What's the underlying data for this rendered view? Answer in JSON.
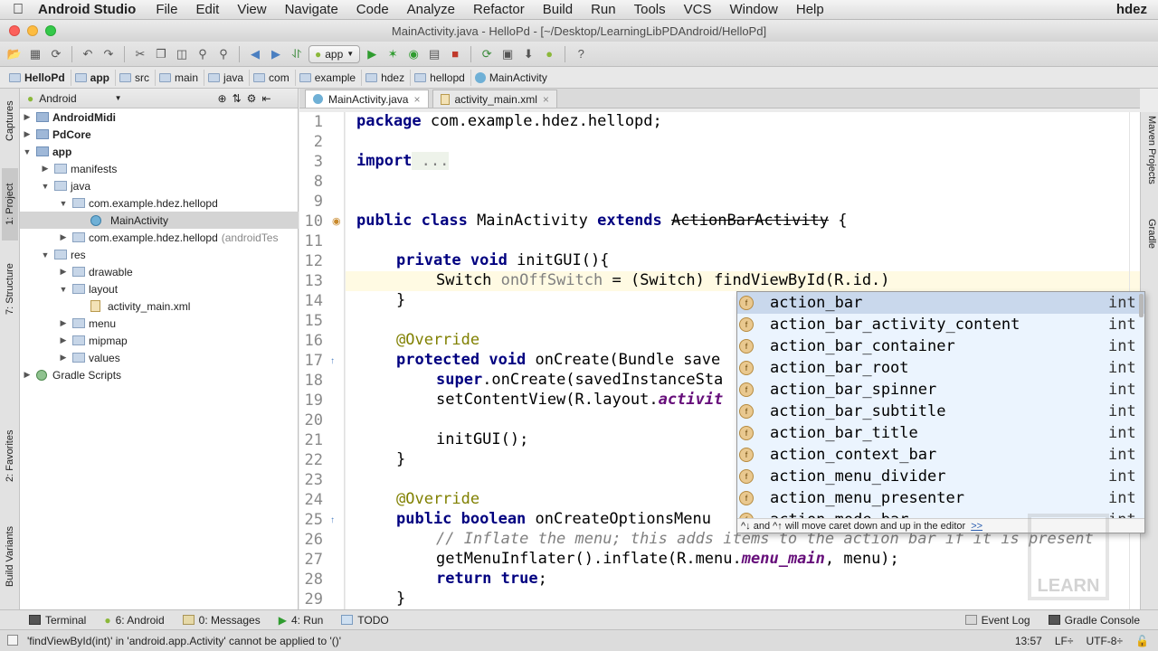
{
  "menubar": {
    "app": "Android Studio",
    "items": [
      "File",
      "Edit",
      "View",
      "Navigate",
      "Code",
      "Analyze",
      "Refactor",
      "Build",
      "Run",
      "Tools",
      "VCS",
      "Window",
      "Help"
    ],
    "user": "hdez"
  },
  "window": {
    "title": "MainActivity.java - HelloPd - [~/Desktop/LearningLibPDAndroid/HelloPd]"
  },
  "toolbar": {
    "run_config": "app"
  },
  "breadcrumbs": [
    "HelloPd",
    "app",
    "src",
    "main",
    "java",
    "com",
    "example",
    "hdez",
    "hellopd",
    "MainActivity"
  ],
  "left_tabs": {
    "captures": "Captures",
    "project": "1: Project",
    "structure": "7: Structure",
    "favorites": "2: Favorites",
    "build_variants": "Build Variants"
  },
  "right_tabs": {
    "maven": "Maven Projects",
    "gradle": "Gradle"
  },
  "project_panel": {
    "view": "Android",
    "tree": [
      {
        "label": "AndroidMidi",
        "bold": true
      },
      {
        "label": "PdCore",
        "bold": true
      },
      {
        "label": "app",
        "bold": true
      },
      {
        "label": "manifests"
      },
      {
        "label": "java"
      },
      {
        "label": "com.example.hdez.hellopd"
      },
      {
        "label": "MainActivity"
      },
      {
        "label": "com.example.hdez.hellopd",
        "suffix": "(androidTes"
      },
      {
        "label": "res"
      },
      {
        "label": "drawable"
      },
      {
        "label": "layout"
      },
      {
        "label": "activity_main.xml"
      },
      {
        "label": "menu"
      },
      {
        "label": "mipmap"
      },
      {
        "label": "values"
      },
      {
        "label": "Gradle Scripts"
      }
    ]
  },
  "editor": {
    "tabs": [
      "MainActivity.java",
      "activity_main.xml"
    ],
    "line_numbers": [
      "1",
      "2",
      "3",
      "8",
      "9",
      "10",
      "11",
      "12",
      "13",
      "14",
      "15",
      "16",
      "17",
      "18",
      "19",
      "20",
      "21",
      "22",
      "23",
      "24",
      "25",
      "26",
      "27",
      "28",
      "29"
    ],
    "code": {
      "l1_kw": "package",
      "l1_rest": " com.example.hdez.hellopd;",
      "l3_kw": "import",
      "l3_rest": " ...",
      "l10_a": "public class",
      "l10_b": " MainActivity ",
      "l10_c": "extends",
      "l10_d": "ActionBarActivity",
      "l10_e": " {",
      "l12_kw": "private void",
      "l12_rest": " initGUI(){",
      "l13_a": "Switch ",
      "l13_b": "onOffSwitch",
      "l13_c": " = (Switch) findViewById(R.id.)",
      "l14": "}",
      "l16": "@Override",
      "l17_kw": "protected void",
      "l17_rest": " onCreate(Bundle save",
      "l18_kw": "super",
      "l18_rest": ".onCreate(savedInstanceSta",
      "l19_a": "setContentView(R.layout.",
      "l19_b": "activit",
      "l21": "initGUI();",
      "l22": "}",
      "l24": "@Override",
      "l25_kw": "public boolean",
      "l25_rest": " onCreateOptionsMenu",
      "l26": "// Inflate the menu; this adds items to the action bar if it is present",
      "l27_a": "getMenuInflater().inflate(R.menu.",
      "l27_b": "menu_main",
      "l27_c": ", menu);",
      "l28_kw": "return true",
      "l28_rest": ";",
      "l29": "}"
    }
  },
  "completion": {
    "items": [
      {
        "name": "action_bar",
        "type": "int"
      },
      {
        "name": "action_bar_activity_content",
        "type": "int"
      },
      {
        "name": "action_bar_container",
        "type": "int"
      },
      {
        "name": "action_bar_root",
        "type": "int"
      },
      {
        "name": "action_bar_spinner",
        "type": "int"
      },
      {
        "name": "action_bar_subtitle",
        "type": "int"
      },
      {
        "name": "action_bar_title",
        "type": "int"
      },
      {
        "name": "action_context_bar",
        "type": "int"
      },
      {
        "name": "action_menu_divider",
        "type": "int"
      },
      {
        "name": "action_menu_presenter",
        "type": "int"
      },
      {
        "name": "action_mode_bar",
        "type": "int"
      }
    ],
    "hint": "^↓ and ^↑ will move caret down and up in the editor",
    "hint_link": ">>"
  },
  "bottom_tools": {
    "terminal": "Terminal",
    "android": "6: Android",
    "messages": "0: Messages",
    "run": "4: Run",
    "todo": "TODO",
    "event_log": "Event Log",
    "gradle_console": "Gradle Console"
  },
  "status": {
    "message": "'findViewById(int)' in 'android.app.Activity' cannot be applied to '()'",
    "position": "13:57",
    "line_sep": "LF÷",
    "encoding": "UTF-8÷"
  },
  "watermark": "LEARN",
  "colors": {
    "keyword": "#000080",
    "annotation": "#808000",
    "field": "#660e7a",
    "comment": "#808080",
    "popup_bg": "#ebf4fe"
  }
}
